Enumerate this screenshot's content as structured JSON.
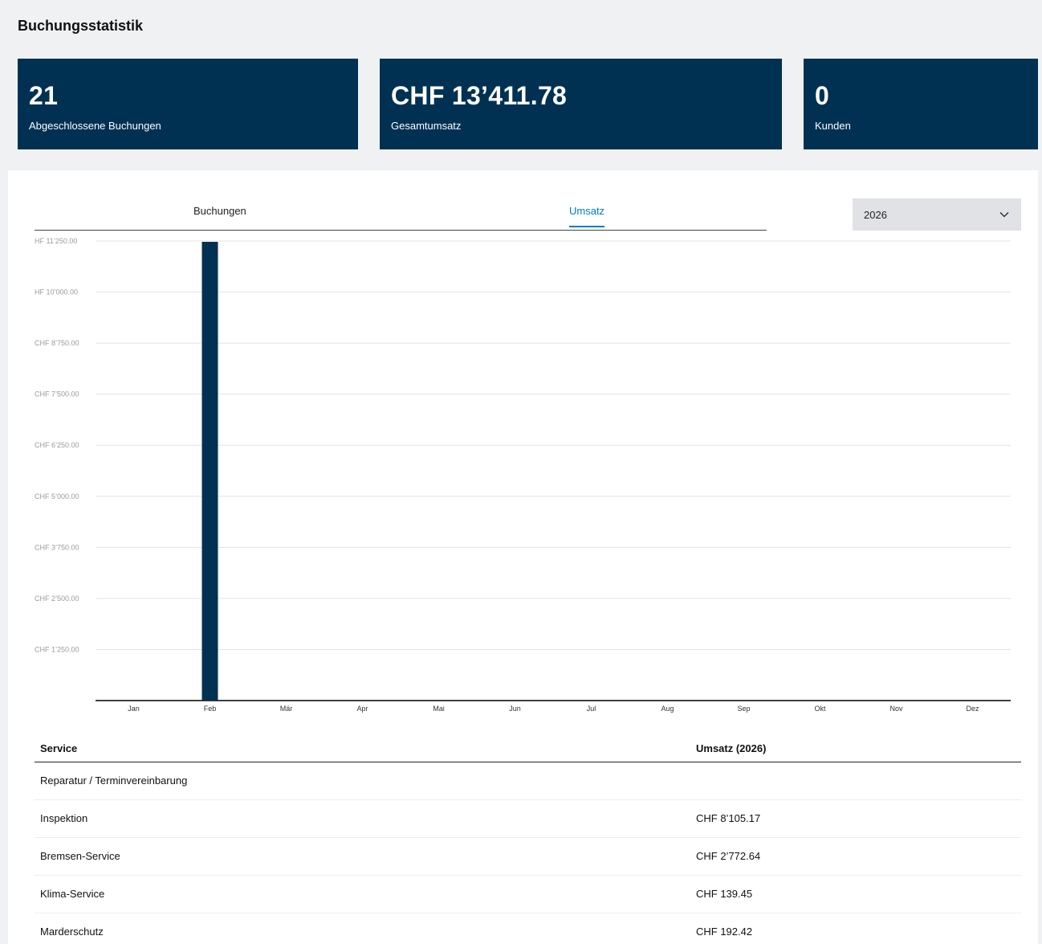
{
  "page": {
    "title": "Buchungsstatistik"
  },
  "kpis": [
    {
      "value": "21",
      "label": "Abgeschlossene Buchungen"
    },
    {
      "value": "CHF 13’411.78",
      "label": "Gesamtumsatz"
    },
    {
      "value": "0",
      "label": "Kunden"
    }
  ],
  "tabs": [
    {
      "label": "Buchungen",
      "active": false
    },
    {
      "label": "Umsatz",
      "active": true
    }
  ],
  "year_select": {
    "value": "2026",
    "icon": "chevron-down-icon"
  },
  "colors": {
    "primary": "#003152",
    "accent": "#007bc0"
  },
  "chart_data": {
    "type": "bar",
    "categories": [
      "Jan",
      "Feb",
      "Mär",
      "Apr",
      "Mai",
      "Jun",
      "Jul",
      "Aug",
      "Sep",
      "Okt",
      "Nov",
      "Dez"
    ],
    "values": [
      0,
      11230,
      0,
      0,
      0,
      0,
      0,
      0,
      0,
      0,
      0,
      0
    ],
    "ylim": [
      0,
      11250
    ],
    "yticks": [
      1250,
      2500,
      3750,
      5000,
      6250,
      7500,
      8750,
      10000,
      11250
    ],
    "ytick_labels": [
      "CHF 1’250.00",
      "CHF 2’500.00",
      "CHF 3’750.00",
      "CHF 5’000.00",
      "CHF 6’250.00",
      "CHF 7’500.00",
      "CHF 8’750.00",
      "HF 10’000.00",
      "HF 11’250.00"
    ],
    "grid": true,
    "title": "",
    "xlabel": "",
    "ylabel": ""
  },
  "table": {
    "headers": {
      "service": "Service",
      "revenue": "Umsatz (2026)"
    },
    "rows": [
      {
        "service": "Reparatur / Terminvereinbarung",
        "revenue": ""
      },
      {
        "service": "Inspektion",
        "revenue": "CHF 8’105.17"
      },
      {
        "service": "Bremsen-Service",
        "revenue": "CHF 2’772.64"
      },
      {
        "service": "Klima-Service",
        "revenue": "CHF 139.45"
      },
      {
        "service": "Marderschutz",
        "revenue": "CHF 192.42"
      }
    ]
  }
}
